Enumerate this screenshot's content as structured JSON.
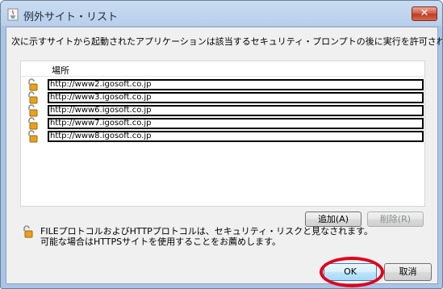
{
  "window": {
    "title": "例外サイト・リスト",
    "close_label": "✕"
  },
  "instruction": "次に示すサイトから起動されたアプリケーションは該当するセキュリティ・プロンプトの後に実行を許可されます。",
  "list": {
    "header": "場所",
    "items": [
      "http://www2.igosoft.co.jp",
      "http://www3.igosoft.co.jp",
      "http://www6.igosoft.co.jp",
      "http://www7.igosoft.co.jp",
      "http://www8.igosoft.co.jp"
    ]
  },
  "buttons": {
    "add": "追加(A)",
    "remove": "削除(R)",
    "ok": "OK",
    "cancel": "取消"
  },
  "warning": {
    "line1": "FILEプロトコルおよびHTTPプロトコルは、セキュリティ・リスクと見なされます。",
    "line2": "可能な場合はHTTPSサイトを使用することをお薦めします。"
  },
  "colors": {
    "highlight": "#e2001a",
    "titlebar": "#b9cfea"
  }
}
